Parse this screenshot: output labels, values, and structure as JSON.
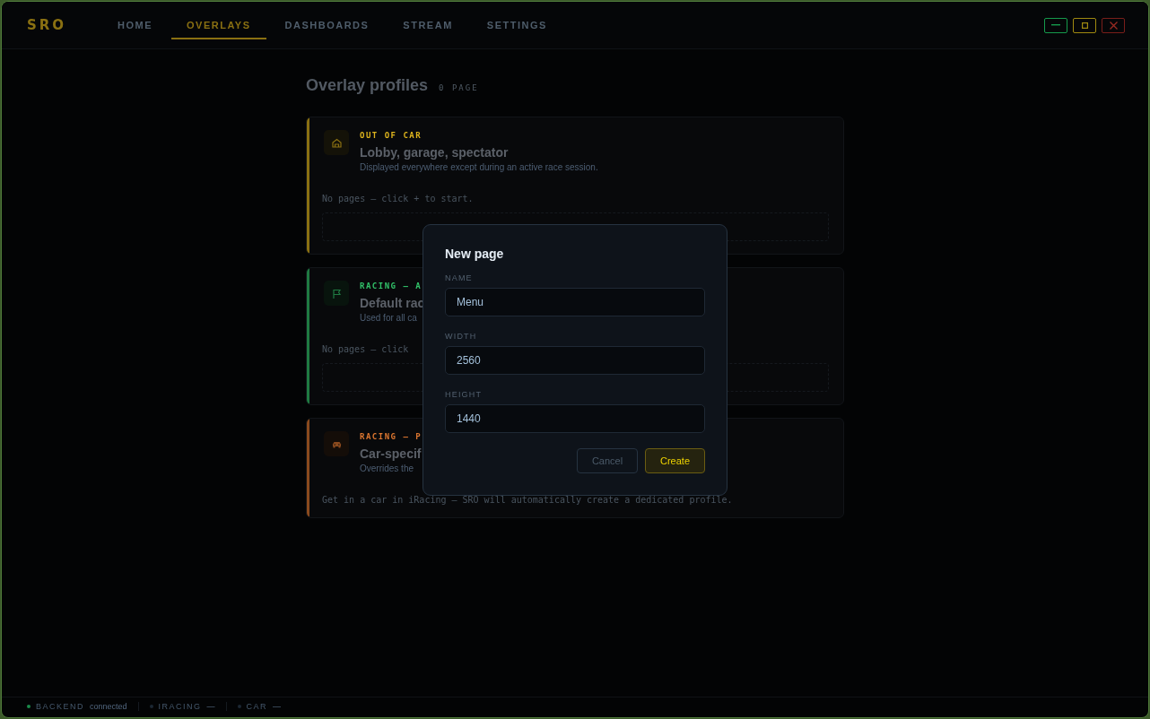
{
  "app": {
    "logo": "SRO"
  },
  "tabs": [
    {
      "label": "HOME",
      "selected": false
    },
    {
      "label": "OVERLAYS",
      "selected": true
    },
    {
      "label": "DASHBOARDS",
      "selected": false
    },
    {
      "label": "STREAM",
      "selected": false
    },
    {
      "label": "SETTINGS",
      "selected": false
    }
  ],
  "window_controls": [
    {
      "kind": "minimize"
    },
    {
      "kind": "maximize"
    },
    {
      "kind": "close"
    }
  ],
  "heading": {
    "title": "Overlay profiles",
    "count": "0 PAGE"
  },
  "profiles": [
    {
      "kind": "out_of_car",
      "color": "#8a7012",
      "label": "OUT OF CAR",
      "title": "Lobby, garage, spectator",
      "description": "Displayed everywhere except during an active race session.",
      "empty_text": "No pages — click + to start."
    },
    {
      "kind": "default",
      "color": "#1f7a42",
      "label": "RACING — A",
      "title": "Default rac",
      "description": "Used for all ca",
      "empty_text": "No pages — click"
    },
    {
      "kind": "car",
      "color": "#8a4a1e",
      "label": "RACING — P",
      "title": "Car-specif",
      "description": "Overrides the",
      "empty_text": "Get in a car in iRacing — SRO will automatically create a dedicated profile."
    }
  ],
  "dialog": {
    "title": "New page",
    "fields": [
      {
        "label": "NAME",
        "value": "Menu"
      },
      {
        "label": "WIDTH",
        "value": "2560"
      },
      {
        "label": "HEIGHT",
        "value": "1440"
      }
    ],
    "buttons": [
      {
        "kind": "secondary",
        "label": "Cancel"
      },
      {
        "kind": "primary",
        "label": "Create"
      }
    ]
  },
  "status_bar": [
    {
      "label": "BACKEND",
      "value": "connected",
      "color": "#1a8a4a"
    },
    {
      "label": "IRACING",
      "value": "—",
      "color": "#1c2733"
    },
    {
      "label": "CAR",
      "value": "—",
      "color": "#1c2733"
    }
  ]
}
